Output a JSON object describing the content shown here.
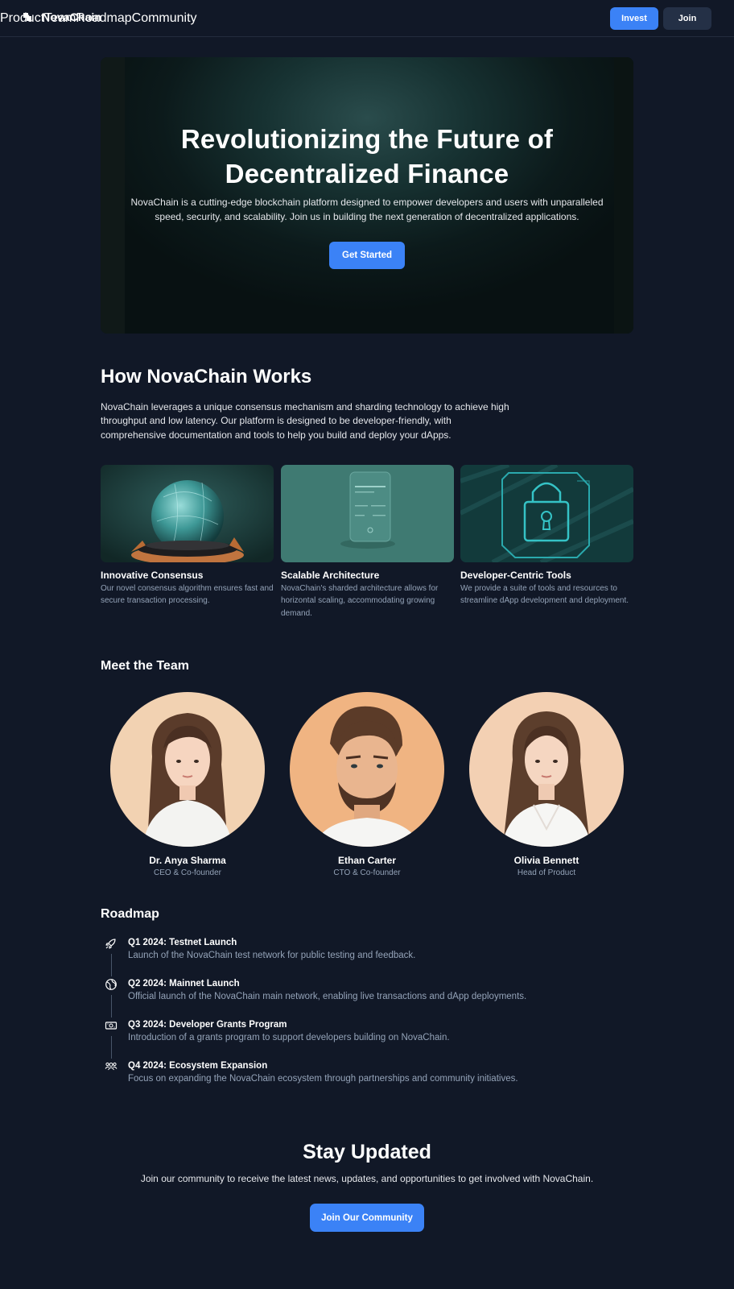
{
  "brand": {
    "name": "NovaChain"
  },
  "nav": {
    "items": [
      "Product",
      "Team",
      "Roadmap",
      "Community"
    ],
    "invest_label": "Invest",
    "join_label": "Join"
  },
  "hero": {
    "title_line1": "Revolutionizing the Future of",
    "title_line2": "Decentralized Finance",
    "subtitle": "NovaChain is a cutting-edge blockchain platform designed to empower developers and users with unparalleled speed, security, and scalability. Join us in building the next generation of decentralized applications.",
    "cta_label": "Get Started"
  },
  "how": {
    "title": "How NovaChain Works",
    "text": "NovaChain leverages a unique consensus mechanism and sharding technology to achieve high throughput and low latency. Our platform is designed to be developer-friendly, with comprehensive documentation and tools to help you build and deploy your dApps.",
    "cards": [
      {
        "title": "Innovative Consensus",
        "text": "Our novel consensus algorithm ensures fast and secure transaction processing.",
        "image": "crystal-ball-image"
      },
      {
        "title": "Scalable Architecture",
        "text": "NovaChain's sharded architecture allows for horizontal scaling, accommodating growing demand.",
        "image": "phone-image"
      },
      {
        "title": "Developer-Centric Tools",
        "text": "We provide a suite of tools and resources to streamline dApp development and deployment.",
        "image": "padlock-image"
      }
    ]
  },
  "team": {
    "title": "Meet the Team",
    "members": [
      {
        "name": "Dr. Anya Sharma",
        "role": "CEO & Co-founder"
      },
      {
        "name": "Ethan Carter",
        "role": "CTO & Co-founder"
      },
      {
        "name": "Olivia Bennett",
        "role": "Head of Product"
      }
    ]
  },
  "roadmap": {
    "title": "Roadmap",
    "items": [
      {
        "icon": "rocket-icon",
        "title": "Q1 2024: Testnet Launch",
        "text": "Launch of the NovaChain test network for public testing and feedback."
      },
      {
        "icon": "globe-icon",
        "title": "Q2 2024: Mainnet Launch",
        "text": "Official launch of the NovaChain main network, enabling live transactions and dApp deployments."
      },
      {
        "icon": "money-icon",
        "title": "Q3 2024: Developer Grants Program",
        "text": "Introduction of a grants program to support developers building on NovaChain."
      },
      {
        "icon": "users-icon",
        "title": "Q4 2024: Ecosystem Expansion",
        "text": "Focus on expanding the NovaChain ecosystem through partnerships and community initiatives."
      }
    ]
  },
  "cta": {
    "title": "Stay Updated",
    "text": "Join our community to receive the latest news, updates, and opportunities to get involved with NovaChain.",
    "button_label": "Join Our Community"
  },
  "colors": {
    "background": "#111827",
    "accent": "#3b82f6",
    "muted_text": "#94a3b8"
  }
}
